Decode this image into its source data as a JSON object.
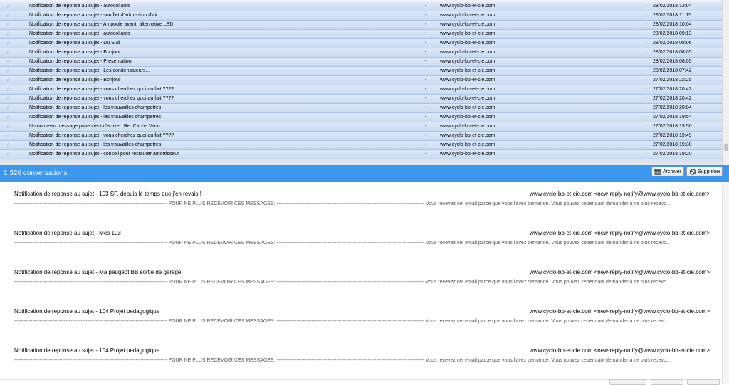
{
  "colors": {
    "header_bg": "#3c98ef",
    "row_bg": "#d4e3f6",
    "row_border": "#a9c1e4"
  },
  "message_list": {
    "rows": [
      {
        "subject": "Notification de reponse au sujet - autocollants",
        "correspondent": "www.cyclo-bb-et-cie.com",
        "date": "28/02/2018 13:04"
      },
      {
        "subject": "Notification de reponse au sujet - soufflet d'admission d'air",
        "correspondent": "www.cyclo-bb-et-cie.com",
        "date": "28/02/2018 11:15"
      },
      {
        "subject": "Notification de reponse au sujet - Ampoule avant: alternative LED",
        "correspondent": "www.cyclo-bb-et-cie.com",
        "date": "28/02/2018 10:04"
      },
      {
        "subject": "Notification de reponse au sujet - autocollants",
        "correspondent": "www.cyclo-bb-et-cie.com",
        "date": "28/02/2018 09:13"
      },
      {
        "subject": "Notification de reponse au sujet - Du Sud",
        "correspondent": "www.cyclo-bb-et-cie.com",
        "date": "28/02/2018 08:06"
      },
      {
        "subject": "Notification de reponse au sujet - Bonjour",
        "correspondent": "www.cyclo-bb-et-cie.com",
        "date": "28/02/2018 08:05"
      },
      {
        "subject": "Notification de reponse au sujet - Presentation",
        "correspondent": "www.cyclo-bb-et-cie.com",
        "date": "28/02/2018 08:05"
      },
      {
        "subject": "Notification de reponse au sujet - Les condensateurs...",
        "correspondent": "www.cyclo-bb-et-cie.com",
        "date": "28/02/2018 07:42"
      },
      {
        "subject": "Notification de reponse au sujet - Bonjour",
        "correspondent": "www.cyclo-bb-et-cie.com",
        "date": "27/02/2018 22:25"
      },
      {
        "subject": "Notification de reponse au sujet - vous cherchez quoi au fait ????",
        "correspondent": "www.cyclo-bb-et-cie.com",
        "date": "27/02/2018 20:43"
      },
      {
        "subject": "Notification de reponse au sujet - vous cherchez quoi au fait ????",
        "correspondent": "www.cyclo-bb-et-cie.com",
        "date": "27/02/2018 20:42"
      },
      {
        "subject": "Notification de reponse au sujet - les trouvailles champetres",
        "correspondent": "www.cyclo-bb-et-cie.com",
        "date": "27/02/2018 20:04"
      },
      {
        "subject": "Notification de reponse au sujet - les trouvailles champetres",
        "correspondent": "www.cyclo-bb-et-cie.com",
        "date": "27/02/2018 19:54"
      },
      {
        "subject": "Un nouveau message prive vient d'arriver: Re: Cache Vario",
        "correspondent": "www.cyclo-bb-et-cie.com",
        "date": "27/02/2018 19:50"
      },
      {
        "subject": "Notification de reponse au sujet - vous cherchez quoi au fait ????",
        "correspondent": "www.cyclo-bb-et-cie.com",
        "date": "27/02/2018 19:49"
      },
      {
        "subject": "Notification de reponse au sujet - les trouvailles champetres",
        "correspondent": "www.cyclo-bb-et-cie.com",
        "date": "27/02/2018 19:30"
      },
      {
        "subject": "Notification de reponse au sujet - conseil pour restaurer amortisseur",
        "correspondent": "www.cyclo-bb-et-cie.com",
        "date": "27/02/2018 19:20"
      }
    ]
  },
  "conversations_header": {
    "count_label": "1 326 conversations",
    "archive_label": "Archiver",
    "delete_label": "Supprimer"
  },
  "conversations": [
    {
      "title": "Notification de reponse au sujet - 103 SP, depuis le temps que j'en revais !",
      "sender": "www.cyclo-bb-et-cie.com <new-reply-notify@www.cyclo-bb-et-cie.com>",
      "preview": "-------------------------------------------------------------------------------------------- POUR NE PLUS RECEVOIR CES MESSAGES: ----------------------------------------------------------------------------------------- Vous recevez cet email parce que vous l'avez demandé. Vous pouvez cependant demander à ne plus recevo..."
    },
    {
      "title": "Notification de reponse au sujet - Mes 103",
      "sender": "www.cyclo-bb-et-cie.com <new-reply-notify@www.cyclo-bb-et-cie.com>",
      "preview": "-------------------------------------------------------------------------------------------- POUR NE PLUS RECEVOIR CES MESSAGES: ----------------------------------------------------------------------------------------- Vous recevez cet email parce que vous l'avez demandé. Vous pouvez cependant demander à ne plus recevo..."
    },
    {
      "title": "Notification de reponse au sujet - Ma peugeot BB sortie de garage",
      "sender": "www.cyclo-bb-et-cie.com <new-reply-notify@www.cyclo-bb-et-cie.com>",
      "preview": "-------------------------------------------------------------------------------------------- POUR NE PLUS RECEVOIR CES MESSAGES: ----------------------------------------------------------------------------------------- Vous recevez cet email parce que vous l'avez demandé. Vous pouvez cependant demander à ne plus recevo..."
    },
    {
      "title": "Notification de reponse au sujet - 104 Projet pedagogique !",
      "sender": "www.cyclo-bb-et-cie.com <new-reply-notify@www.cyclo-bb-et-cie.com>",
      "preview": "-------------------------------------------------------------------------------------------- POUR NE PLUS RECEVOIR CES MESSAGES: ----------------------------------------------------------------------------------------- Vous recevez cet email parce que vous l'avez demandé. Vous pouvez cependant demander à ne plus recevo..."
    },
    {
      "title": "Notification de reponse au sujet - 104 Projet pedagogique !",
      "sender": "www.cyclo-bb-et-cie.com <new-reply-notify@www.cyclo-bb-et-cie.com>",
      "preview": "-------------------------------------------------------------------------------------------- POUR NE PLUS RECEVOIR CES MESSAGES: ----------------------------------------------------------------------------------------- Vous recevez cet email parce que vous l'avez demandé. Vous pouvez cependant demander à ne plus recevo..."
    }
  ]
}
